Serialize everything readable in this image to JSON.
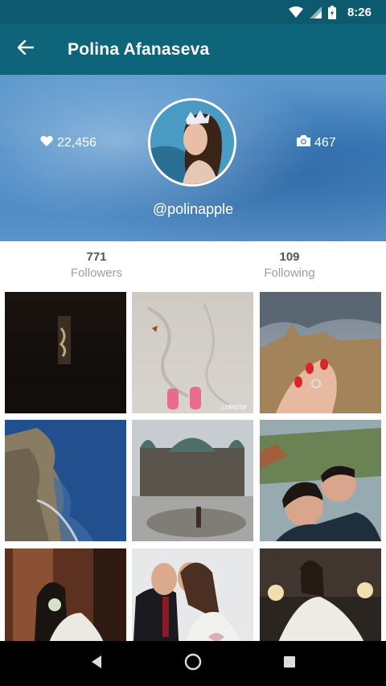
{
  "status_bar": {
    "time": "8:26"
  },
  "app_bar": {
    "title": "Polina Afanaseva"
  },
  "profile": {
    "likes": "22,456",
    "photos": "467",
    "handle": "@polinapple"
  },
  "follow": {
    "followers_count": "771",
    "followers_label": "Followers",
    "following_count": "109",
    "following_label": "Following"
  },
  "grid": {
    "watermark": "LOMOTIF"
  },
  "colors": {
    "status_bar": "#0d5a6e",
    "app_bar": "#0e6479",
    "header_blue": "#3d7fbe"
  },
  "icons": [
    "back-arrow-icon",
    "heart-icon",
    "camera-icon",
    "wifi-icon",
    "signal-icon",
    "battery-icon",
    "nav-back-icon",
    "nav-home-icon",
    "nav-recents-icon"
  ]
}
